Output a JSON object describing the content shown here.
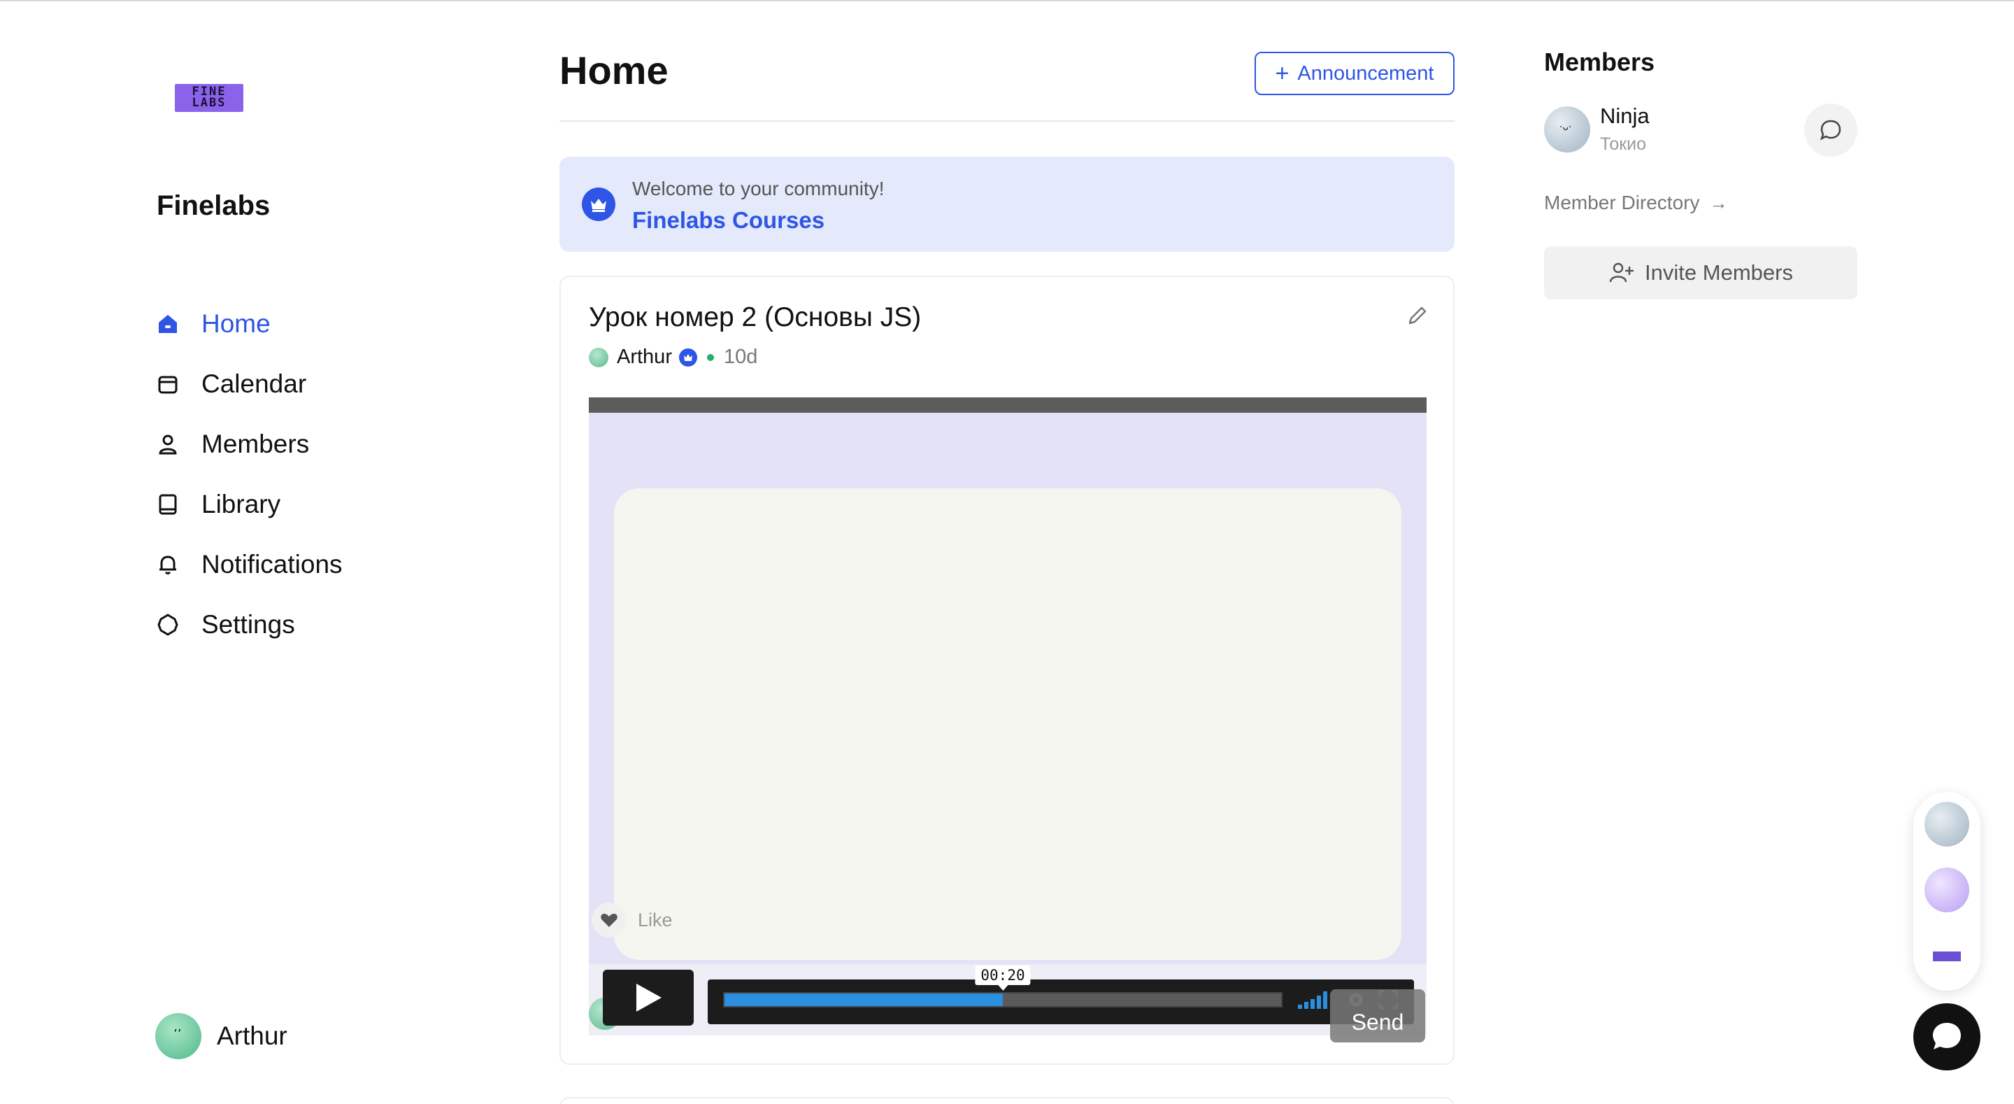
{
  "community": {
    "logo_text": "FINE\nLABS",
    "name": "Finelabs"
  },
  "nav": {
    "items": [
      {
        "label": "Home",
        "icon": "home-icon",
        "active": true
      },
      {
        "label": "Calendar",
        "icon": "calendar-icon"
      },
      {
        "label": "Members",
        "icon": "person-icon"
      },
      {
        "label": "Library",
        "icon": "book-icon"
      },
      {
        "label": "Notifications",
        "icon": "bell-icon"
      },
      {
        "label": "Settings",
        "icon": "gear-icon"
      }
    ]
  },
  "current_user": {
    "name": "Arthur"
  },
  "header": {
    "title": "Home",
    "announcement_button": "Announcement"
  },
  "welcome": {
    "text": "Welcome to your community!",
    "link": "Finelabs Courses"
  },
  "post": {
    "title": "Урок номер 2 (Основы JS)",
    "author": "Arthur",
    "age": "10d",
    "like_label": "Like",
    "send_label": "Send",
    "video": {
      "timestamp": "00:20",
      "progress": 0.5
    }
  },
  "members_panel": {
    "heading": "Members",
    "members": [
      {
        "name": "Ninja",
        "location": "Токио"
      }
    ],
    "directory_link": "Member Directory",
    "invite_button": "Invite Members"
  },
  "colors": {
    "accent": "#2e55e6",
    "welcome_bg": "#e4e9fb",
    "video_bg": "#e3e2f6",
    "progress": "#2b8fe0"
  }
}
